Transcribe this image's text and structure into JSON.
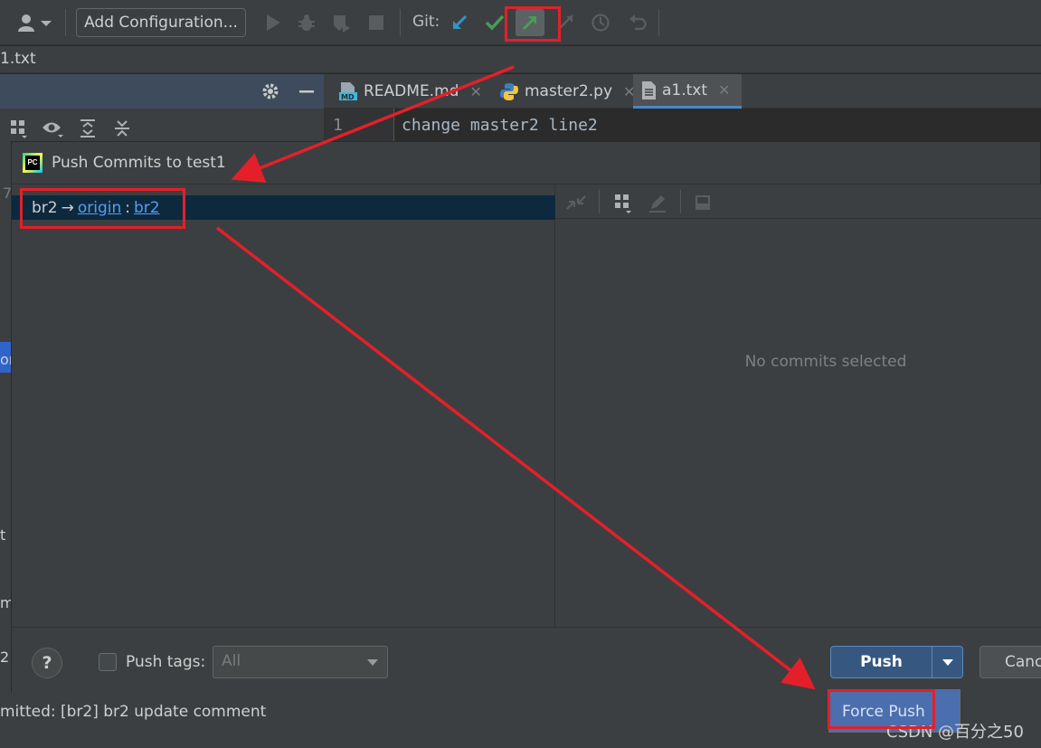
{
  "toolbar": {
    "add_configuration_label": "Add Configuration...",
    "git_label": "Git:"
  },
  "breadcrumb": {
    "file": "1.txt"
  },
  "editor": {
    "tabs": [
      {
        "label": "README.md"
      },
      {
        "label": "master2.py"
      },
      {
        "label": "a1.txt"
      }
    ],
    "line_number": "1",
    "code_line": "change master2 line2"
  },
  "dialog": {
    "title": "Push Commits to test1",
    "push_row": {
      "local_branch": "br2",
      "arrow": "→",
      "remote": "origin",
      "separator": ":",
      "remote_branch": "br2"
    },
    "empty_message": "No commits selected",
    "push_tags_label": "Push tags:",
    "tags_select_value": "All",
    "push_label": "Push",
    "cancel_label": "Cancel"
  },
  "status_bar": {
    "text": "mitted: [br2] br2 update comment"
  },
  "popup": {
    "force_push_label": "Force Push"
  },
  "watermark": "CSDN @百分之50",
  "left_scraps": {
    "a": "7",
    "b": "or",
    "c": "t a",
    "d": "m",
    "e": "2"
  },
  "colors": {
    "annotation_red": "#e3202a",
    "link_blue": "#589df6",
    "selection_bg": "#0d293e",
    "primary_button": "#365880",
    "popup_bg": "#4b6eaf"
  }
}
